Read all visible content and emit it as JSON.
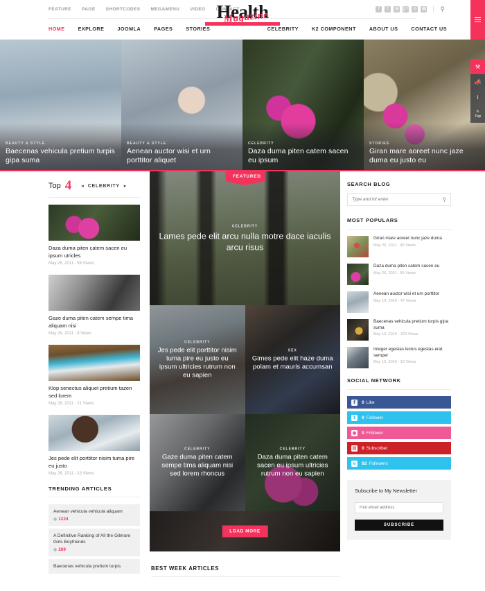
{
  "header": {
    "top_menu": [
      "FEATURE",
      "PAGE",
      "SHORTCODES",
      "MEGAMENU",
      "VIDEO",
      "CONTACT"
    ],
    "social_icons": [
      "facebook-icon",
      "twitter-icon",
      "rss-icon",
      "google-plus-icon",
      "instagram-icon",
      "flickr-icon"
    ],
    "social_glyphs": [
      "f",
      "t",
      "▤",
      "g+",
      "◎",
      "▦"
    ],
    "search_icon": "search-icon",
    "logo": {
      "main": "Health",
      "script": "Magazine"
    },
    "main_menu_left": [
      {
        "label": "HOME",
        "active": true
      },
      {
        "label": "EXPLORE",
        "active": false
      },
      {
        "label": "JOOMLA",
        "active": false
      },
      {
        "label": "PAGES",
        "active": false
      },
      {
        "label": "STORIES",
        "active": false
      }
    ],
    "main_menu_right": [
      {
        "label": "CELEBRITY"
      },
      {
        "label": "K2 COMPONENT"
      },
      {
        "label": "ABOUT US"
      },
      {
        "label": "CONTACT US"
      }
    ]
  },
  "rail": {
    "menu_icon": "hamburger-icon",
    "buttons": [
      {
        "name": "settings-wrench-icon",
        "glyph": "⚒",
        "label": ""
      },
      {
        "name": "megaphone-icon",
        "glyph": "📣",
        "label": ""
      },
      {
        "name": "info-icon",
        "glyph": "i",
        "label": ""
      },
      {
        "name": "scroll-top-icon",
        "glyph": "∧",
        "label": "Top"
      }
    ]
  },
  "hero": [
    {
      "category": "STORIES",
      "title": "Giran mare aoreet nunc jaze duma eu justo eu",
      "img": "img-flowers1"
    },
    {
      "category": "CELEBRITY",
      "title": "Daza duma piten catem sacen eu ipsum",
      "img": "img-bike"
    },
    {
      "category": "BEAUTY & STYLE",
      "title": "Aenean auctor wisi et urn porttitor aliquet",
      "img": "img-couple1"
    },
    {
      "category": "BEAUTY & STYLE",
      "title": "Baecenas vehicula pretium turpis gipa suma",
      "img": "img-beach"
    }
  ],
  "left": {
    "top_label": "Top",
    "top_number": "4",
    "prev_icon": "arrow-left-icon",
    "next_icon": "arrow-right-icon",
    "category": "CELEBRITY",
    "posts": [
      {
        "title": "Daza duma piten catem sacen eu ipsum utricles",
        "meta": "May 26, 2011 - 56 Views",
        "img": "img-p1"
      },
      {
        "title": "Gaze duma piten catem sempe tima aliquam nisi",
        "meta": "May 26, 2011 - 8 Views",
        "img": "img-p2"
      },
      {
        "title": "Klop senectus aliquet pretium tazen sed lorem",
        "meta": "May 26, 2011 - 21 Views",
        "img": "img-p3"
      },
      {
        "title": "Jes pede elit porttitor nisim tuma pire eu justo",
        "meta": "May 26, 2011 - 23 Views",
        "img": "img-p4"
      }
    ],
    "trending_heading": "TRENDING ARTICLES",
    "trending": [
      {
        "title": "Aenean vehicula vehicula aliquam",
        "views": "1224"
      },
      {
        "title": "A Definitive Ranking of All the Gilmore Girls Boyfriends",
        "views": "269"
      },
      {
        "title": "Baecenas vehicula pretium turpis",
        "views": ""
      }
    ]
  },
  "main": {
    "featured_badge": "FEATURED",
    "featured": {
      "category": "CELEBRITY",
      "title": "Lames pede elit arcu nulla motre dace iaculis arcu risus",
      "img": "img-forest"
    },
    "cells": [
      {
        "category": "CELEBRITY",
        "title": "Jes pede elit porttitor nisim tuma pire eu justo eu ipsum ultricies rutrum non eu sapien",
        "img": "img-beachgirl"
      },
      {
        "category": "SEX",
        "title": "Gimes pede elit haze duma polam et mauris accumsan",
        "img": "img-sex"
      },
      {
        "category": "CELEBRITY",
        "title": "Gaze duma piten catem sempe tima aliquam nisi sed lorem rhoncus",
        "img": "img-bw"
      },
      {
        "category": "CELEBRITY",
        "title": "Daza duma piten catem sacen eu ipsum ultricies rutrum non eu sapien",
        "img": "img-pinkfl"
      }
    ],
    "load_more": "LOAD MORE",
    "best_week_heading": "BEST WEEK ARTICLES"
  },
  "sidebar": {
    "search_heading": "SEARCH BLOG",
    "search_placeholder": "Type and hit enter",
    "search_icon": "search-icon",
    "popular_heading": "MOST POPULARS",
    "popular": [
      {
        "title": "Giran mare aoreet nunc jaze duma",
        "meta": "May 26, 2011 - 40 Views",
        "img": "img-s1"
      },
      {
        "title": "Daza duma piten catem sacen eu",
        "meta": "May 26, 2011 - 59 Views",
        "img": "img-s2"
      },
      {
        "title": "Aenean auctor wisi et um porttitor",
        "meta": "May 10, 2015 - 47 Views",
        "img": "img-s3"
      },
      {
        "title": "Baecenas vehicula pretium turpis gipa suma",
        "meta": "May 10, 2015 - 204 Views",
        "img": "img-s4"
      },
      {
        "title": "Integer egestas lectus egestas erat semper",
        "meta": "May 10, 2015 - 12 Views",
        "img": "img-s5"
      }
    ],
    "social_heading": "SOCIAL NETWORK",
    "social": [
      {
        "icon": "facebook-icon",
        "glyph": "f",
        "count": "0",
        "label": "Like",
        "color": "#3a5795"
      },
      {
        "icon": "twitter-icon",
        "glyph": "t",
        "count": "0",
        "label": "Follower",
        "color": "#2fc2ef"
      },
      {
        "icon": "dribbble-icon",
        "glyph": "●",
        "count": "0",
        "label": "Follower",
        "color": "#ef5a96"
      },
      {
        "icon": "rss-icon",
        "glyph": "▤",
        "count": "0",
        "label": "Subscriber",
        "color": "#cc2127"
      },
      {
        "icon": "vimeo-icon",
        "glyph": "v",
        "count": "82",
        "label": "Followers",
        "color": "#2fc2ef"
      }
    ],
    "newsletter_heading": "Subscribe to My Newsletter",
    "newsletter_placeholder": "Your email address",
    "newsletter_button": "SUBSCRIBE"
  }
}
